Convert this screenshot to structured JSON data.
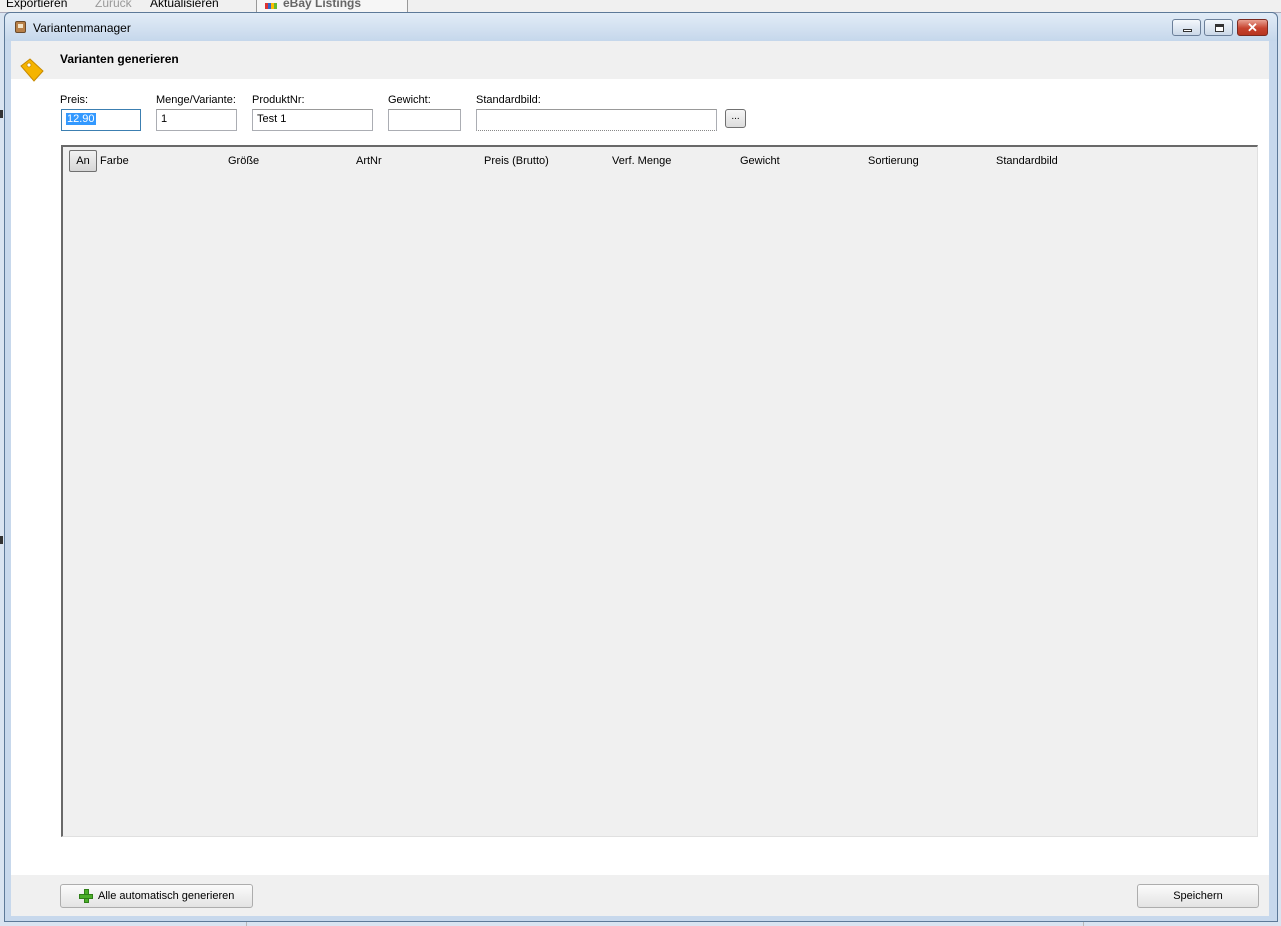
{
  "background_app": {
    "button_1": "Exportieren",
    "button_2": "Zurück",
    "button_3": "Aktualisieren",
    "tab_label": "eBay Listings"
  },
  "window": {
    "title": "Variantenmanager",
    "close_glyph": "✕"
  },
  "header": {
    "heading": "Varianten generieren",
    "icon": "price-tag-icon"
  },
  "fields": {
    "preis": {
      "label": "Preis:",
      "value": "12.90"
    },
    "menge": {
      "label": "Menge/Variante:",
      "value": "1"
    },
    "produktnr": {
      "label": "ProduktNr:",
      "value": "Test 1"
    },
    "gewicht": {
      "label": "Gewicht:",
      "value": ""
    },
    "standardbild": {
      "label": "Standardbild:",
      "value": "",
      "browse_label": "..."
    }
  },
  "grid": {
    "toggle_label": "An",
    "columns": [
      "Farbe",
      "Größe",
      "ArtNr",
      "Preis (Brutto)",
      "Verf. Menge",
      "Gewicht",
      "Sortierung",
      "Standardbild"
    ]
  },
  "footer": {
    "generate_label": "Alle automatisch generieren",
    "save_label": "Speichern"
  },
  "colors": {
    "selection": "#3399ff",
    "tag_icon": "#f5b400",
    "close_button": "#c7422e",
    "plus_icon": "#4caf2a"
  }
}
